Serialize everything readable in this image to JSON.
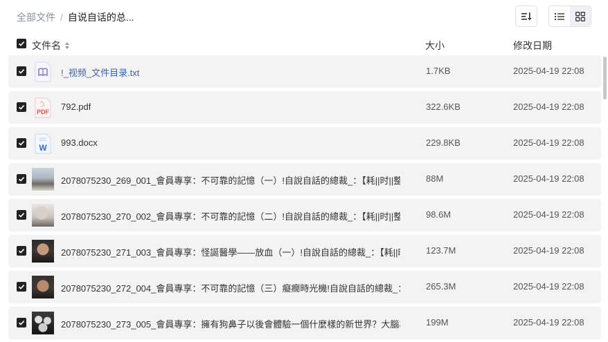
{
  "breadcrumb": {
    "root": "全部文件",
    "separator": "/",
    "current": "自说自话的总..."
  },
  "toolbar": {
    "sort_icon": "sort-icon",
    "list_view_icon": "list-view-icon",
    "grid_view_icon": "grid-view-icon",
    "active_view": "list"
  },
  "columns": {
    "name": "文件名",
    "size": "大小",
    "date": "修改日期"
  },
  "files": [
    {
      "name": "!_视频_文件目录.txt",
      "size": "1.7KB",
      "date": "2025-04-19 22:08",
      "icon": "txt-file-icon",
      "checked": true
    },
    {
      "name": "792.pdf",
      "size": "322.6KB",
      "date": "2025-04-19 22:08",
      "icon": "pdf-file-icon",
      "icon_text": "PDF",
      "checked": true
    },
    {
      "name": "993.docx",
      "size": "229.8KB",
      "date": "2025-04-19 22:08",
      "icon": "word-file-icon",
      "icon_text": "W",
      "checked": true
    },
    {
      "name": "2078075230_269_001_會員專享：不可靠的記憶（一）!自說自話的總裁_：【耗||时||整...",
      "size": "88M",
      "date": "2025-04-19 22:08",
      "icon": "video-thumbnail",
      "checked": true
    },
    {
      "name": "2078075230_270_002_會員專享：不可靠的記憶（二）!自說自話的總裁_：【耗||时||整...",
      "size": "98.6M",
      "date": "2025-04-19 22:08",
      "icon": "video-thumbnail",
      "checked": true
    },
    {
      "name": "2078075230_271_003_會員專享：怪誕醫學——放血（一）!自說自話的總裁_：【耗||时...",
      "size": "123.7M",
      "date": "2025-04-19 22:08",
      "icon": "video-thumbnail",
      "checked": true
    },
    {
      "name": "2078075230_272_004_會員專享：不可靠的記憶（三）癡癇時光機!自說自話的總裁_：...",
      "size": "265.3M",
      "date": "2025-04-19 22:08",
      "icon": "video-thumbnail",
      "checked": true
    },
    {
      "name": "2078075230_273_005_會員專享：擁有狗鼻子以後會體驗一個什麼樣的新世界？大腦為...",
      "size": "199M",
      "date": "2025-04-19 22:08",
      "icon": "video-thumbnail",
      "checked": true
    }
  ],
  "colors": {
    "link": "#3662c9",
    "row_bg": "#f3f3f4",
    "checkbox": "#222222",
    "pdf_red": "#e0584c",
    "word_blue": "#2b6fd6",
    "txt_purple": "#7c6cd6"
  }
}
